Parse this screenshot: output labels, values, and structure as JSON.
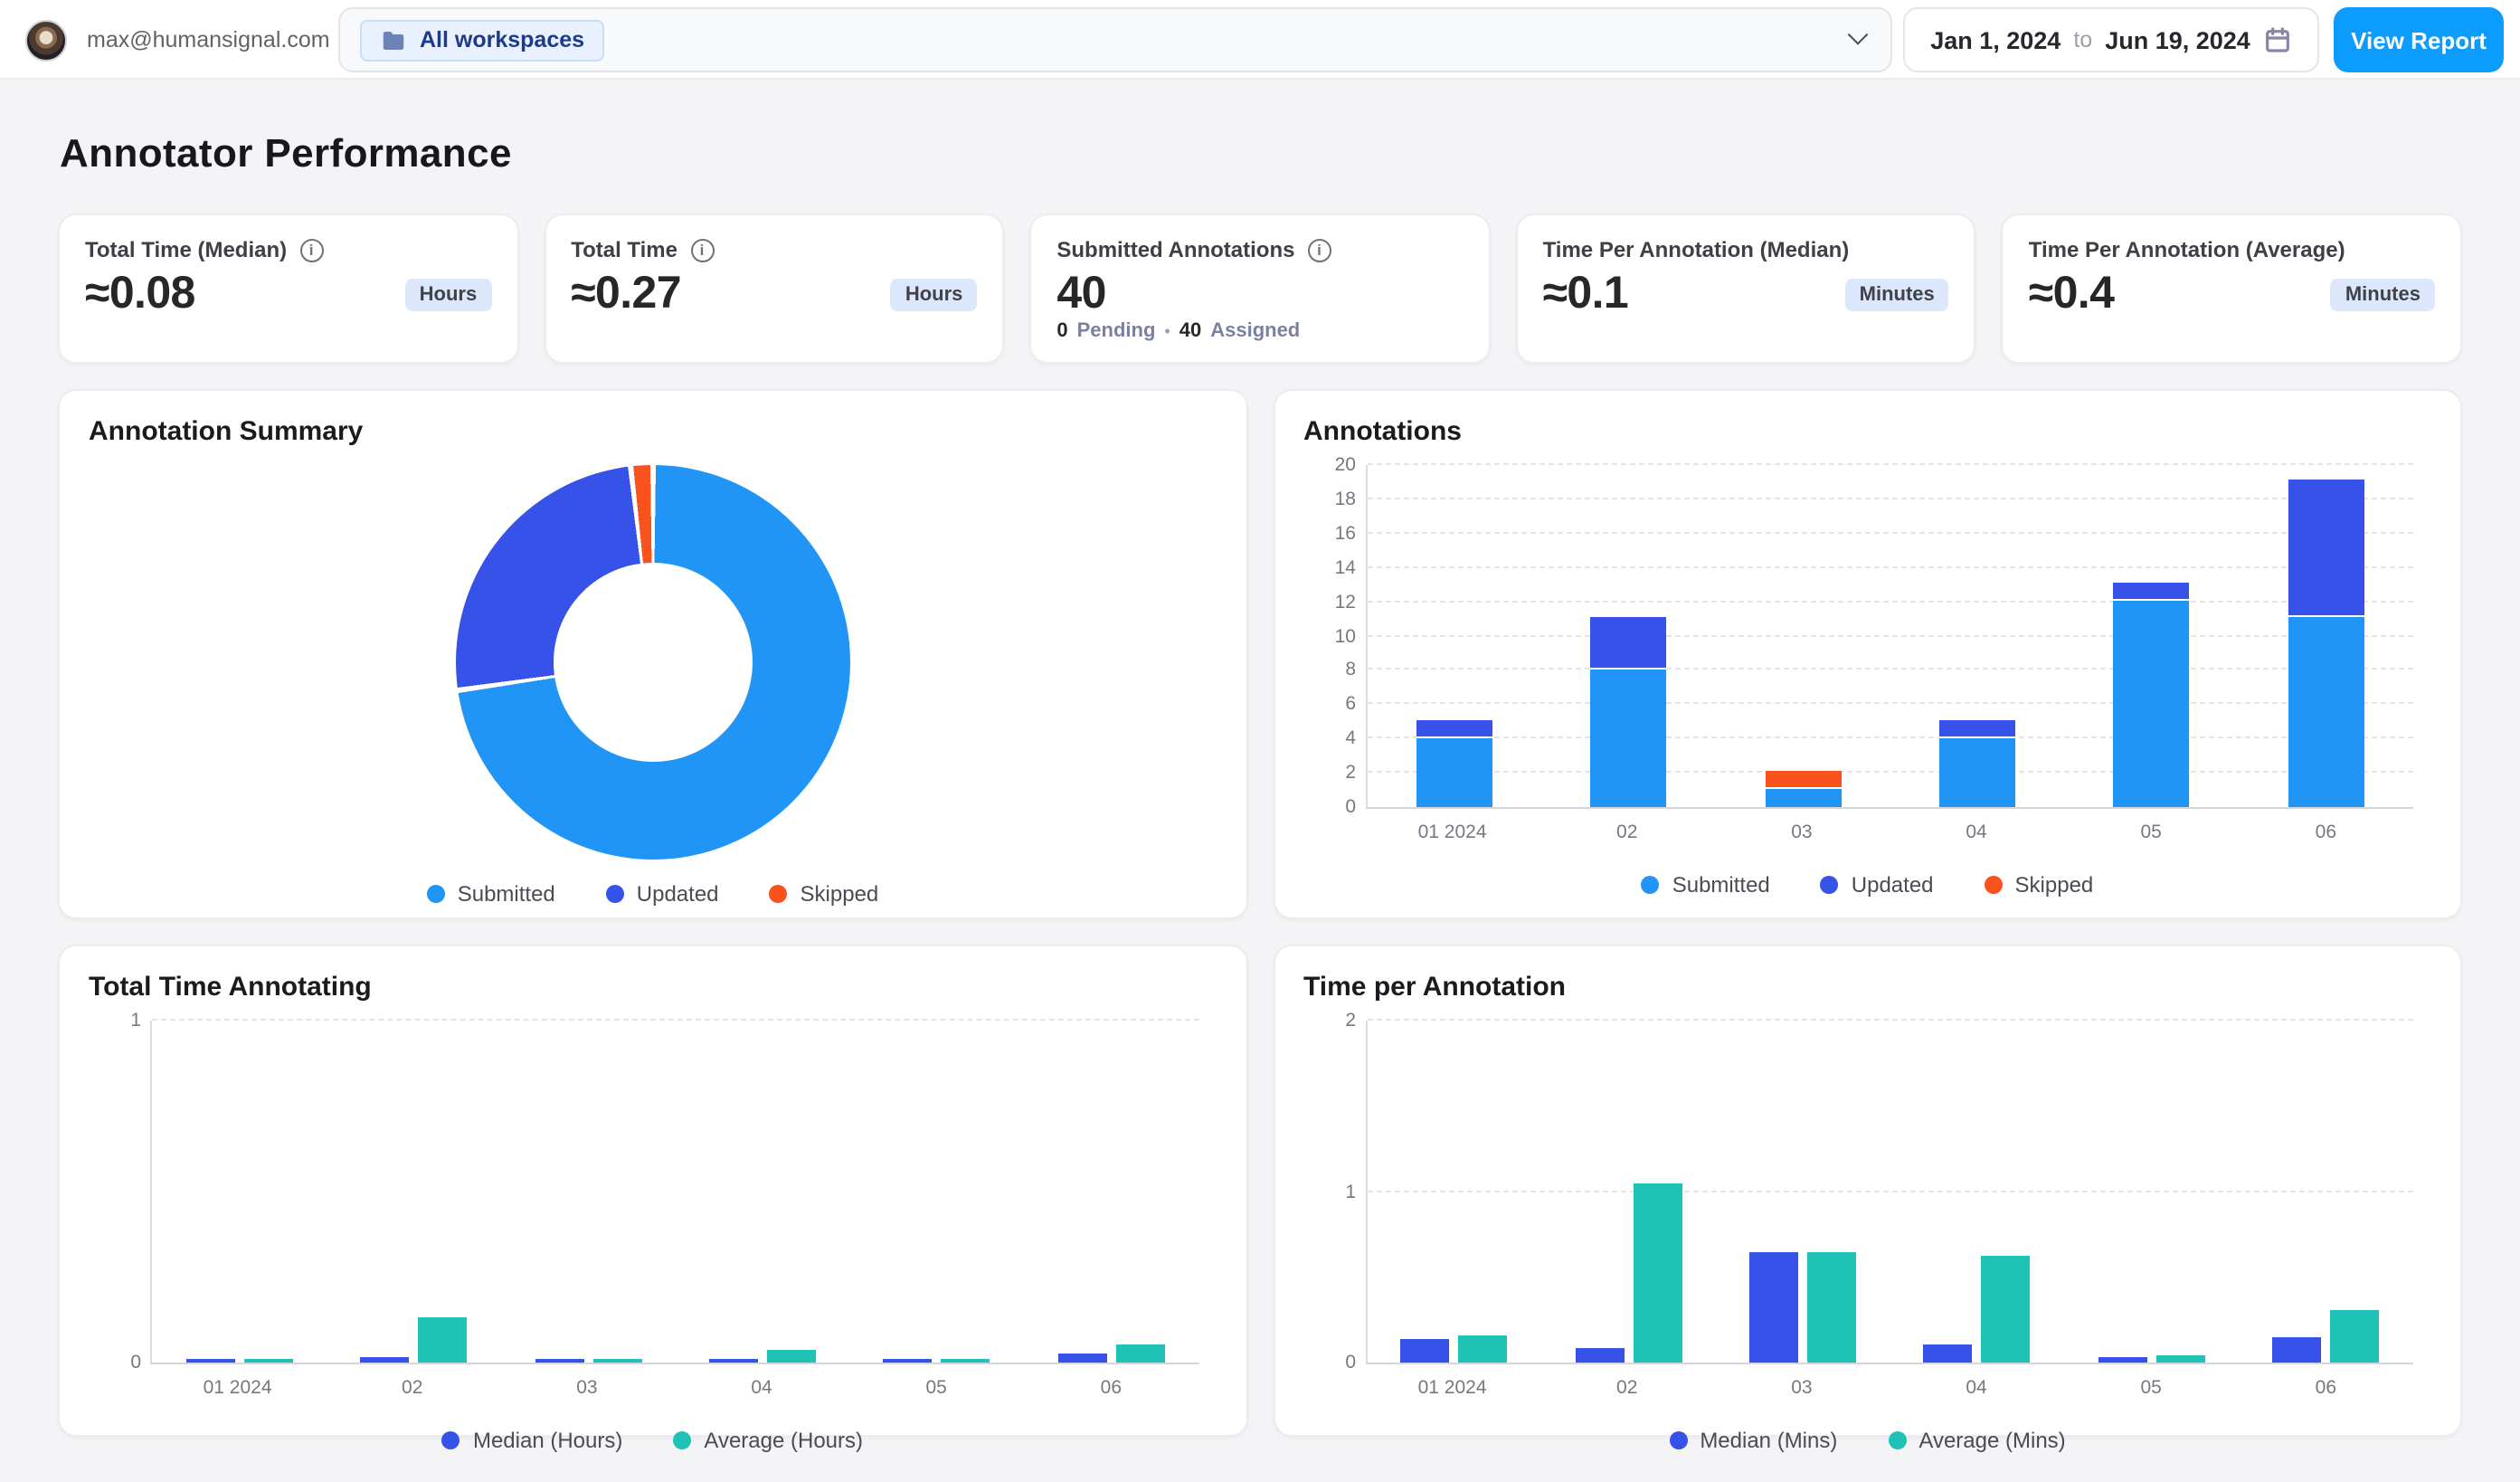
{
  "header": {
    "email": "max@humansignal.com",
    "workspace_selector": {
      "chip_label": "All workspaces"
    },
    "date_range": {
      "start": "Jan 1, 2024",
      "separator": "to",
      "end": "Jun 19, 2024"
    },
    "view_report_label": "View Report"
  },
  "page": {
    "title": "Annotator Performance"
  },
  "cards": [
    {
      "label": "Total Time (Median)",
      "value": "≈0.08",
      "unit_badge": "Hours"
    },
    {
      "label": "Total Time",
      "value": "≈0.27",
      "unit_badge": "Hours"
    },
    {
      "label": "Submitted Annotations",
      "value": "40",
      "footer": {
        "pending_count": "0",
        "pending_label": "Pending",
        "separator": "•",
        "assigned_count": "40",
        "assigned_label": "Assigned"
      }
    },
    {
      "label": "Time Per Annotation (Median)",
      "value": "≈0.1",
      "unit_badge": "Minutes"
    },
    {
      "label": "Time Per Annotation (Average)",
      "value": "≈0.4",
      "unit_badge": "Minutes"
    }
  ],
  "colors": {
    "accent_blue": "#0C9BFE",
    "submitted": "#2095F5",
    "updated": "#3752E8",
    "skipped": "#F9521D",
    "teal": "#1FC3B5"
  },
  "chart_data": [
    {
      "id": "summary",
      "type": "pie",
      "donut": true,
      "title": "Annotation Summary",
      "labels": [
        "Submitted",
        "Updated",
        "Skipped"
      ],
      "values": [
        40,
        14,
        1
      ],
      "colors": [
        "#2095F5",
        "#3752E8",
        "#F9521D"
      ],
      "legend_position": "bottom"
    },
    {
      "id": "annotations",
      "type": "bar",
      "stacked": true,
      "title": "Annotations",
      "categories": [
        "01 2024",
        "02",
        "03",
        "04",
        "05",
        "06"
      ],
      "series": [
        {
          "name": "Submitted",
          "color": "#2095F5",
          "values": [
            4,
            8,
            1,
            4,
            12,
            11
          ]
        },
        {
          "name": "Updated",
          "color": "#3752E8",
          "values": [
            1,
            3,
            0,
            1,
            1,
            8
          ]
        },
        {
          "name": "Skipped",
          "color": "#F9521D",
          "values": [
            0,
            0,
            1,
            0,
            0,
            0
          ]
        }
      ],
      "ylim": [
        0,
        20
      ],
      "ytick_step": 2,
      "grid": "dashed",
      "legend_position": "bottom"
    },
    {
      "id": "total_time",
      "type": "bar",
      "grouped": true,
      "title": "Total Time Annotating",
      "categories": [
        "01 2024",
        "02",
        "03",
        "04",
        "05",
        "06"
      ],
      "series": [
        {
          "name": "Median (Hours)",
          "color": "#3752E8",
          "values": [
            0.01,
            0.015,
            0.012,
            0.008,
            0.006,
            0.025
          ]
        },
        {
          "name": "Average (Hours)",
          "color": "#1FC3B5",
          "values": [
            0.012,
            0.13,
            0.01,
            0.036,
            0.01,
            0.052
          ]
        }
      ],
      "ylim": [
        0,
        1
      ],
      "yticks": [
        0,
        1
      ],
      "grid": "dashed",
      "legend_position": "bottom"
    },
    {
      "id": "time_per",
      "type": "bar",
      "grouped": true,
      "title": "Time per Annotation",
      "categories": [
        "01 2024",
        "02",
        "03",
        "04",
        "05",
        "06"
      ],
      "series": [
        {
          "name": "Median (Mins)",
          "color": "#3752E8",
          "values": [
            0.14,
            0.08,
            0.64,
            0.11,
            0.03,
            0.15
          ]
        },
        {
          "name": "Average (Mins)",
          "color": "#1FC3B5",
          "values": [
            0.16,
            1.04,
            0.64,
            0.62,
            0.04,
            0.3
          ]
        }
      ],
      "ylim": [
        0,
        2
      ],
      "yticks": [
        0,
        1,
        2
      ],
      "grid": "dashed",
      "legend_position": "bottom"
    }
  ]
}
